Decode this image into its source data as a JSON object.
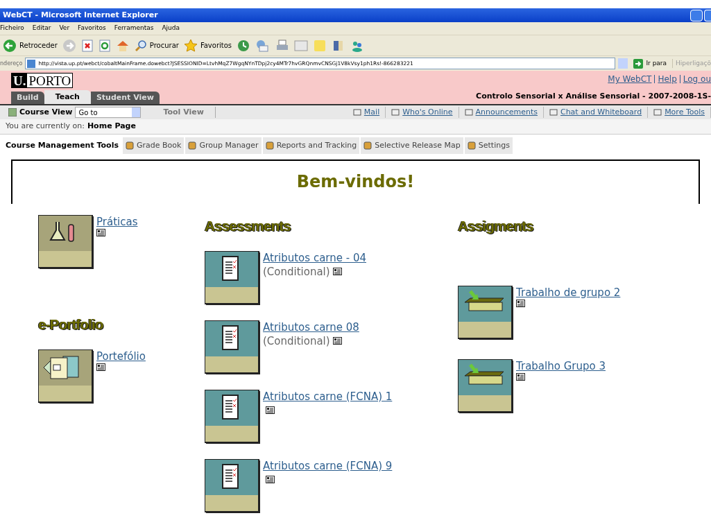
{
  "window": {
    "title": "WebCT - Microsoft Internet Explorer"
  },
  "menu": [
    "Ficheiro",
    "Editar",
    "Ver",
    "Favoritos",
    "Ferramentas",
    "Ajuda"
  ],
  "toolbar": [
    {
      "kind": "back",
      "label": "Retroceder"
    },
    {
      "kind": "forward"
    },
    {
      "kind": "stop"
    },
    {
      "kind": "refresh"
    },
    {
      "kind": "home"
    },
    {
      "kind": "search",
      "label": "Procurar"
    },
    {
      "kind": "favorites",
      "label": "Favoritos"
    },
    {
      "kind": "history"
    },
    {
      "kind": "mail"
    },
    {
      "kind": "print"
    },
    {
      "kind": "edit"
    },
    {
      "kind": "note"
    },
    {
      "kind": "research"
    },
    {
      "kind": "messenger"
    }
  ],
  "address_bar": {
    "label": "ndereço",
    "value": "http://vista.up.pt/webct/cobaltMainFrame.dowebct?JSESSIONID=LtvhMqZ7WgqNYnTDpj2cy4MTr7hvGRQnmvCNSGj1V8kVsy1ph1Rs!-866283221",
    "go": "Ir para",
    "links": "Hiperligaçõ"
  },
  "header": {
    "logo_mark": "U.",
    "logo_text": "PORTO",
    "links": [
      "My WebCT",
      "Help",
      "Log ou"
    ],
    "course": "Controlo Sensorial x Análise Sensorial - 2007-2008-1S-"
  },
  "tabs": [
    {
      "label": "Build",
      "selected": false
    },
    {
      "label": "Teach",
      "selected": true
    },
    {
      "label": "Student View",
      "selected": false
    }
  ],
  "view_bar": {
    "course_view": "Course View",
    "goto": "Go to",
    "tool_view": "Tool View",
    "tools": [
      "Mail",
      "Who's Online",
      "Announcements",
      "Chat and Whiteboard",
      "More Tools"
    ]
  },
  "breadcrumb": {
    "label": "You are currently on:",
    "page": "Home Page"
  },
  "management": {
    "label": "Course Management Tools",
    "tools": [
      "Grade Book",
      "Group Manager",
      "Reports and Tracking",
      "Selective Release Map",
      "Settings"
    ]
  },
  "welcome": "Bem-vindos!",
  "columns": [
    {
      "sections": [
        {
          "items": [
            {
              "kind": "lab",
              "title": "Práticas"
            }
          ]
        },
        {
          "heading": "e-Portfolio",
          "items": [
            {
              "kind": "portfolio",
              "title": "Portefólio"
            }
          ]
        }
      ]
    },
    {
      "sections": [
        {
          "heading": "Assessments",
          "items": [
            {
              "kind": "quiz",
              "title": "Atributos carne - 04",
              "note": "(Conditional)"
            },
            {
              "kind": "quiz",
              "title": "Atributos carne 08",
              "note": "(Conditional)"
            },
            {
              "kind": "quiz",
              "title": "Atributos carne (FCNA) 1"
            },
            {
              "kind": "quiz",
              "title": "Atributos carne (FCNA) 9"
            }
          ]
        }
      ]
    },
    {
      "sections": [
        {
          "heading": "Assigments",
          "items": [
            {
              "kind": "dropbox",
              "title": "Trabalho de grupo 2"
            },
            {
              "kind": "dropbox",
              "title": "Trabalho Grupo 3"
            }
          ]
        }
      ]
    }
  ]
}
